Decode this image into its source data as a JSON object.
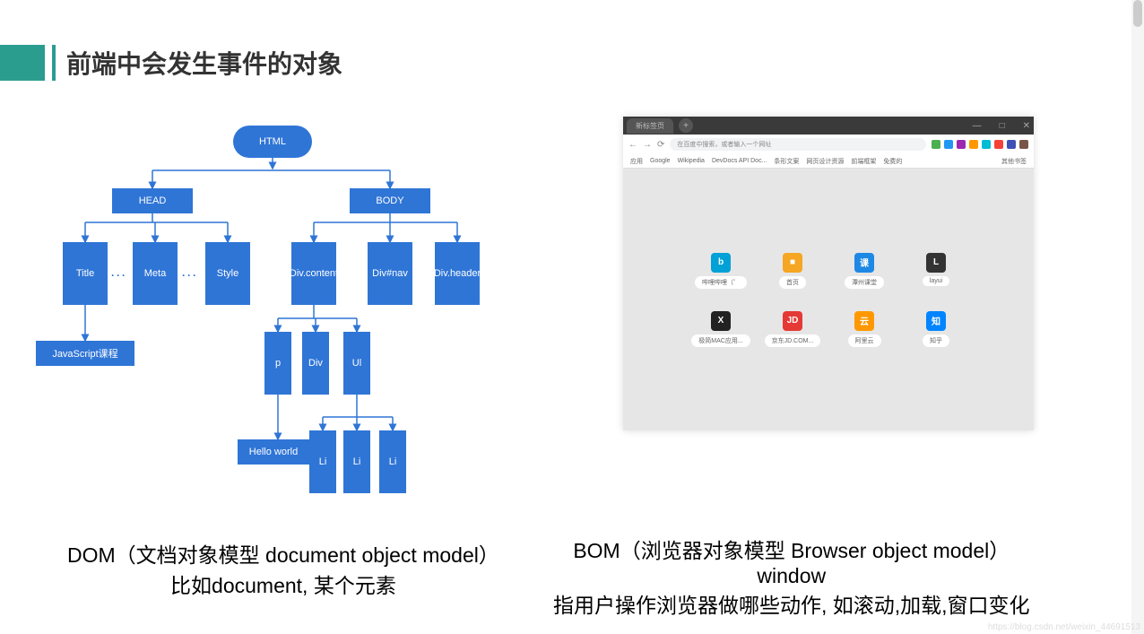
{
  "title": "前端中会发生事件的对象",
  "tree": {
    "n0": "HTML",
    "n1": "HEAD",
    "n2": "BODY",
    "n3": "Title",
    "n4": "Meta",
    "n5": "Style",
    "n6": "Div.content",
    "n7": "Div#nav",
    "n8": "Div.header",
    "n9": "JavaScript课程",
    "n10": "p",
    "n11": "Div",
    "n12": "Ul",
    "n13": "Hello world",
    "n14": "Li",
    "n15": "Li",
    "n16": "Li"
  },
  "dotsA": "···",
  "dotsB": "···",
  "left_desc_line1": "DOM（文档对象模型 document object model）",
  "left_desc_line2": "比如document, 某个元素",
  "right_desc_line1": "BOM（浏览器对象模型 Browser object model）",
  "right_desc_line2": "window",
  "right_desc_line3": "指用户操作浏览器做哪些动作, 如滚动,加载,窗口变化",
  "browser": {
    "tab": "新标签页",
    "newtab_plus": "+",
    "win_min": "—",
    "win_max": "□",
    "win_close": "✕",
    "nav_back": "←",
    "nav_fwd": "→",
    "nav_reload": "⟳",
    "url_placeholder": "在百度中搜索，或者输入一个网址",
    "ext_colors": [
      "#4caf50",
      "#2196f3",
      "#9c27b0",
      "#ff9800",
      "#00bcd4",
      "#f44336",
      "#3f51b5",
      "#795548"
    ],
    "bookmarks": [
      "应用",
      "Google",
      "Wikipedia",
      "DevDocs API Doc...",
      "条形文案",
      "网页设计资源",
      "前端框架",
      "免费的"
    ],
    "bookmark_right": "其他书签",
    "tiles": [
      {
        "label": "哔哩哔哩（゜",
        "bg": "#00a1d6",
        "txt": "b"
      },
      {
        "label": "首页",
        "bg": "#f5a623",
        "txt": "■"
      },
      {
        "label": "潭州课堂",
        "bg": "#1e88e5",
        "txt": "课"
      },
      {
        "label": "layui",
        "bg": "#333",
        "txt": "L"
      },
      {
        "label": "极简MAC应用...",
        "bg": "#222",
        "txt": "X"
      },
      {
        "label": "京东JD.COM...",
        "bg": "#e53935",
        "txt": "JD"
      },
      {
        "label": "阿里云",
        "bg": "#ff9800",
        "txt": "云"
      },
      {
        "label": "知乎",
        "bg": "#0084ff",
        "txt": "知"
      }
    ]
  },
  "watermark": "https://blog.csdn.net/weixin_44691513"
}
